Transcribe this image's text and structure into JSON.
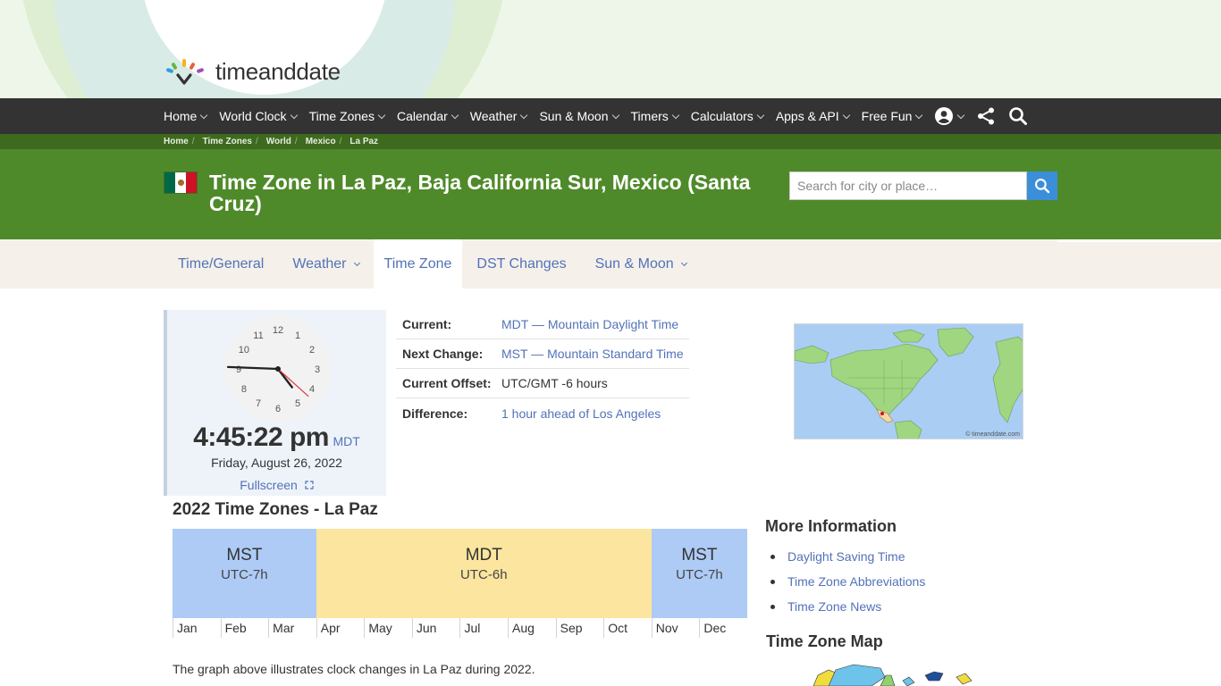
{
  "brand": {
    "name": "timeanddate"
  },
  "nav": {
    "items": [
      {
        "label": "Home"
      },
      {
        "label": "World Clock"
      },
      {
        "label": "Time Zones"
      },
      {
        "label": "Calendar"
      },
      {
        "label": "Weather"
      },
      {
        "label": "Sun & Moon"
      },
      {
        "label": "Timers"
      },
      {
        "label": "Calculators"
      },
      {
        "label": "Apps & API"
      },
      {
        "label": "Free Fun"
      }
    ],
    "icons": [
      "account-icon",
      "share-icon",
      "search-icon"
    ]
  },
  "breadcrumb": [
    "Home",
    "Time Zones",
    "World",
    "Mexico",
    "La Paz"
  ],
  "page": {
    "title": "Time Zone in La Paz, Baja California Sur, Mexico (Santa Cruz)",
    "flag_colors": [
      "#006847",
      "#ffffff",
      "#ce1126"
    ]
  },
  "search": {
    "placeholder": "Search for city or place…",
    "button_color": "#3b8fd9"
  },
  "tabs": [
    {
      "label": "Time/General",
      "has_menu": false,
      "active": false
    },
    {
      "label": "Weather",
      "has_menu": true,
      "active": false
    },
    {
      "label": "Time Zone",
      "has_menu": false,
      "active": true
    },
    {
      "label": "DST Changes",
      "has_menu": false,
      "active": false
    },
    {
      "label": "Sun & Moon",
      "has_menu": true,
      "active": false
    }
  ],
  "clock": {
    "numerals": [
      "12",
      "1",
      "2",
      "3",
      "4",
      "5",
      "6",
      "7",
      "8",
      "9",
      "10",
      "11"
    ],
    "time": "4:45:22 pm",
    "tz": "MDT",
    "date": "Friday, August 26, 2022",
    "fullscreen_label": "Fullscreen",
    "hours": 16,
    "minutes": 45,
    "seconds": 22
  },
  "info": [
    {
      "key": "Current:",
      "value": "MDT — Mountain Daylight Time",
      "link": true
    },
    {
      "key": "Next Change:",
      "value": "MST — Mountain Standard Time",
      "link": true
    },
    {
      "key": "Current Offset:",
      "value": "UTC/GMT -6 hours",
      "link": false
    },
    {
      "key": "Difference:",
      "value": "1 hour ahead of Los Angeles",
      "link": true
    }
  ],
  "map": {
    "credit": "© timeanddate.com",
    "ocean_color": "#aacdf3",
    "land_color": "#9fd67f"
  },
  "timeline": {
    "title": "2022 Time Zones - La Paz",
    "segments": [
      {
        "abbr": "MST",
        "offset": "UTC-7h",
        "months": 3,
        "color": "#aecbf6"
      },
      {
        "abbr": "MDT",
        "offset": "UTC-6h",
        "months": 7,
        "color": "#fce59e"
      },
      {
        "abbr": "MST",
        "offset": "UTC-7h",
        "months": 2,
        "color": "#aecbf6"
      }
    ],
    "months": [
      "Jan",
      "Feb",
      "Mar",
      "Apr",
      "May",
      "Jun",
      "Jul",
      "Aug",
      "Sep",
      "Oct",
      "Nov",
      "Dec"
    ],
    "caption": "The graph above illustrates clock changes in La Paz during 2022."
  },
  "more_info": {
    "title": "More Information",
    "links": [
      "Daylight Saving Time",
      "Time Zone Abbreviations",
      "Time Zone News"
    ]
  },
  "tz_map": {
    "title": "Time Zone Map"
  }
}
